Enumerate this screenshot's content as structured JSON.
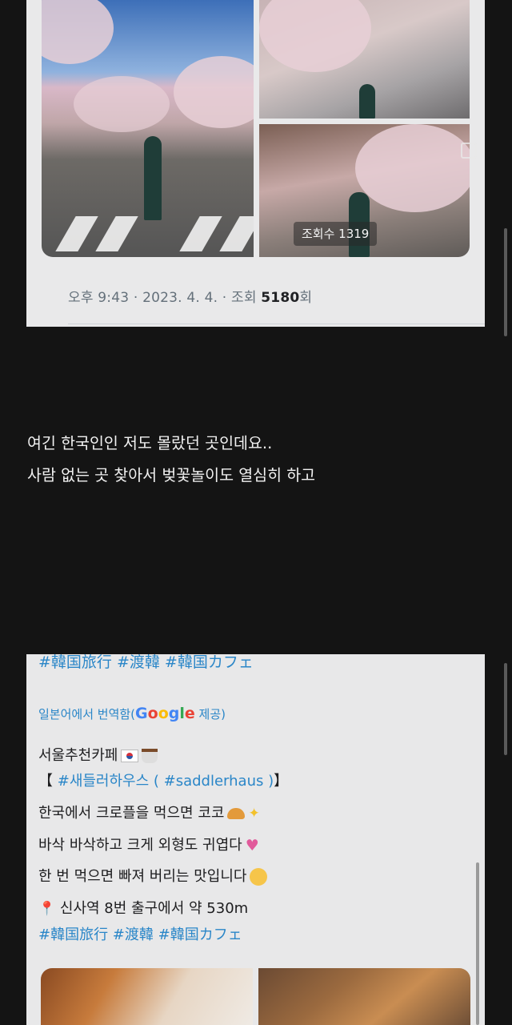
{
  "post1": {
    "view_badge": "조회수 1319",
    "meta_time_date": "오후 9:43 · 2023. 4. 4. · 조회 ",
    "meta_views": "5180",
    "meta_suffix": "회"
  },
  "caption": {
    "line1": "여긴 한국인인 저도 몰랐던 곳인데요..",
    "line2": "사람 없는 곳 찾아서 벚꽃놀이도 열심히 하고"
  },
  "post2": {
    "cut_tags": "#韓国旅行 #渡韓 #韓国カフェ",
    "translated_prefix": "일본어에서 번역함(",
    "translated_suffix": " 제공)",
    "google": [
      "G",
      "o",
      "o",
      "g",
      "l",
      "e"
    ],
    "google_colors": [
      "#4285F4",
      "#EA4335",
      "#FBBC05",
      "#4285F4",
      "#34A853",
      "#EA4335"
    ],
    "line1": "서울추천카페",
    "line2_open": "【 ",
    "line2_tag": "#새들러하우스 ( #saddlerhaus )",
    "line2_close": "】",
    "line3": "한국에서 크로플을 먹으면 코코",
    "line4": "바삭 바삭하고 크게 외형도 귀엽다",
    "line5": "한 번 먹으면 빠져 버리는 맛입니다",
    "line6": "신사역 8번 출구에서 약 530m",
    "tags": "#韓国旅行 #渡韓 #韓国カフェ"
  },
  "icons": [
    "flag-kr-icon",
    "coffee-icon",
    "croissant-icon",
    "sparkle-icon",
    "heart-icon",
    "smile-icon",
    "pin-icon",
    "gif-icon"
  ]
}
